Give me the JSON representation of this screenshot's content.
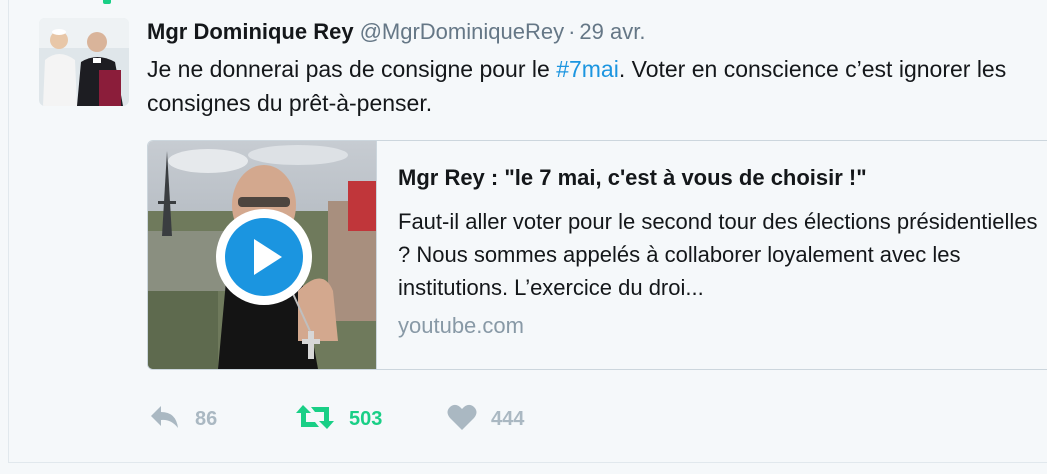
{
  "tweet": {
    "author_name": "Mgr Dominique Rey",
    "author_handle": "@MgrDominiqueRey",
    "separator": "·",
    "timestamp": "29 avr.",
    "text_before": "Je ne donnerai pas de consigne pour le ",
    "hashtag": "#7mai",
    "text_after": ". Voter en conscience c’est ignorer les consignes du prêt-à-penser.",
    "avatar_icon": "bishop-photo-avatar"
  },
  "card": {
    "title": "Mgr Rey : \"le 7 mai, c'est à vous de choisir !\"",
    "description": "Faut-il aller voter pour le second tour des élections présidentielles ? Nous sommes appelés à collaborer loyalement avec les institutions. L’exercice du droi...",
    "domain": "youtube.com",
    "play_icon": "play-icon"
  },
  "actions": {
    "reply_count": "86",
    "retweet_count": "503",
    "like_count": "444"
  },
  "colors": {
    "link": "#1b95e0",
    "retweet_active": "#19cf86",
    "muted": "#aab8c2"
  }
}
